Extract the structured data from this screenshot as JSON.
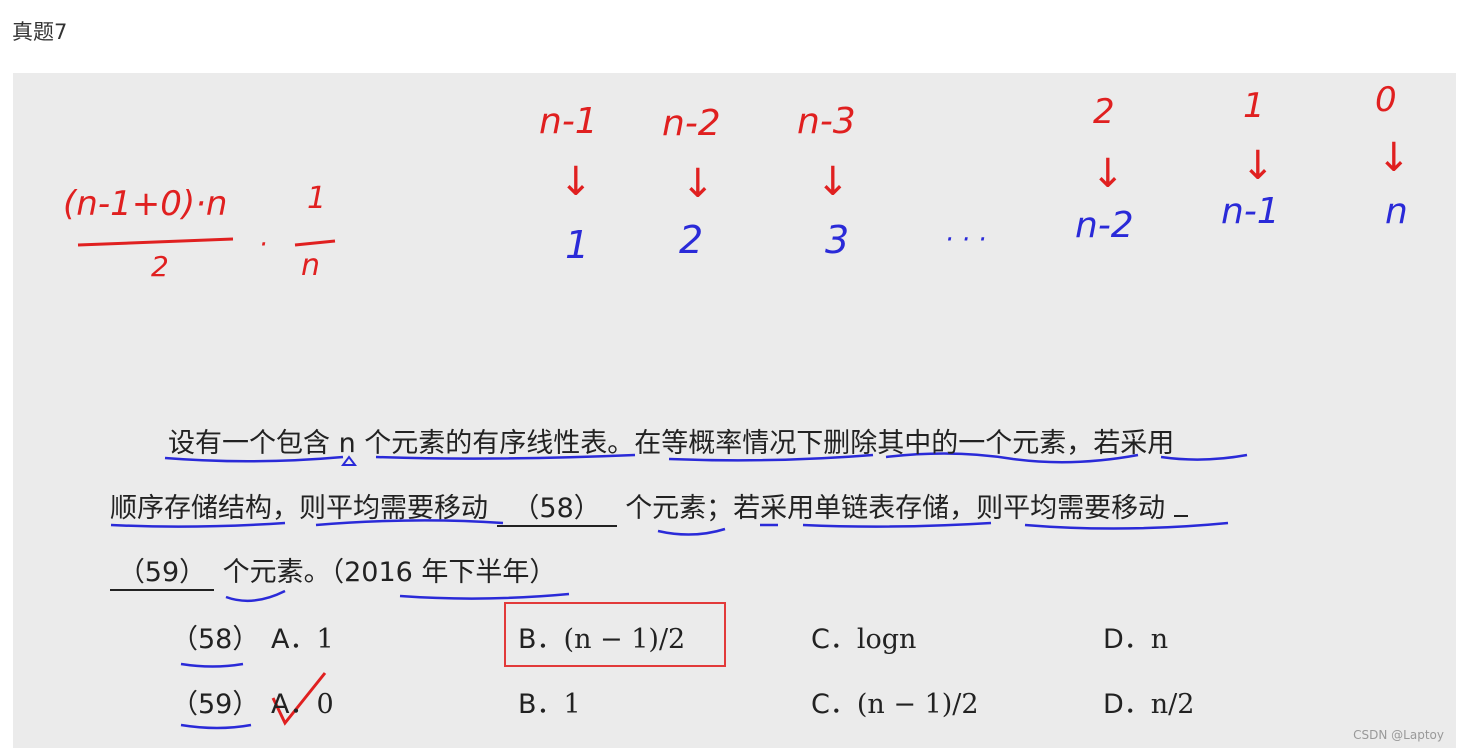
{
  "page_heading": "真题7",
  "handwriting": {
    "formula_numerator": "(n-1+0)·n",
    "formula_denominator": "2",
    "formula_fraction_num": "1",
    "formula_fraction_den": "n",
    "formula_dot": "·",
    "top_row": [
      "n-1",
      "n-2",
      "n-3",
      "2",
      "1",
      "0"
    ],
    "bottom_row": [
      "1",
      "2",
      "3",
      "n-2",
      "n-1",
      "n"
    ],
    "ellipsis": "· · ·",
    "arrow": "↓"
  },
  "question": {
    "line1_part1": "设有一个包含 n 个元素的有序线性表。在等概率情况下删除其中的一个元素，若采用",
    "line2_part1": "顺序存储结构，则平均需要移动",
    "blank58": "（58）",
    "line2_part2": "个元素；若采用单链表存储，则平均需要移动",
    "blank59": "（59）",
    "line3_part2": "个元素。（2016 年下半年）"
  },
  "options": {
    "q58": {
      "label": "（58）",
      "a_label": "A．",
      "a": "1",
      "b_label": "B．",
      "b": "(n − 1)/2",
      "c_label": "C．",
      "c": "logn",
      "d_label": "D．",
      "d": "n"
    },
    "q59": {
      "label": "（59）",
      "a_label": "A．",
      "a": "0",
      "b_label": "B．",
      "b": "1",
      "c_label": "C．",
      "c": "(n − 1)/2",
      "d_label": "D．",
      "d": "n/2"
    }
  },
  "watermark": "CSDN @Laptoy",
  "colors": {
    "red_ink": "#e02020",
    "blue_ink": "#2a2ad8",
    "highlight_box": "#e23a3a"
  }
}
